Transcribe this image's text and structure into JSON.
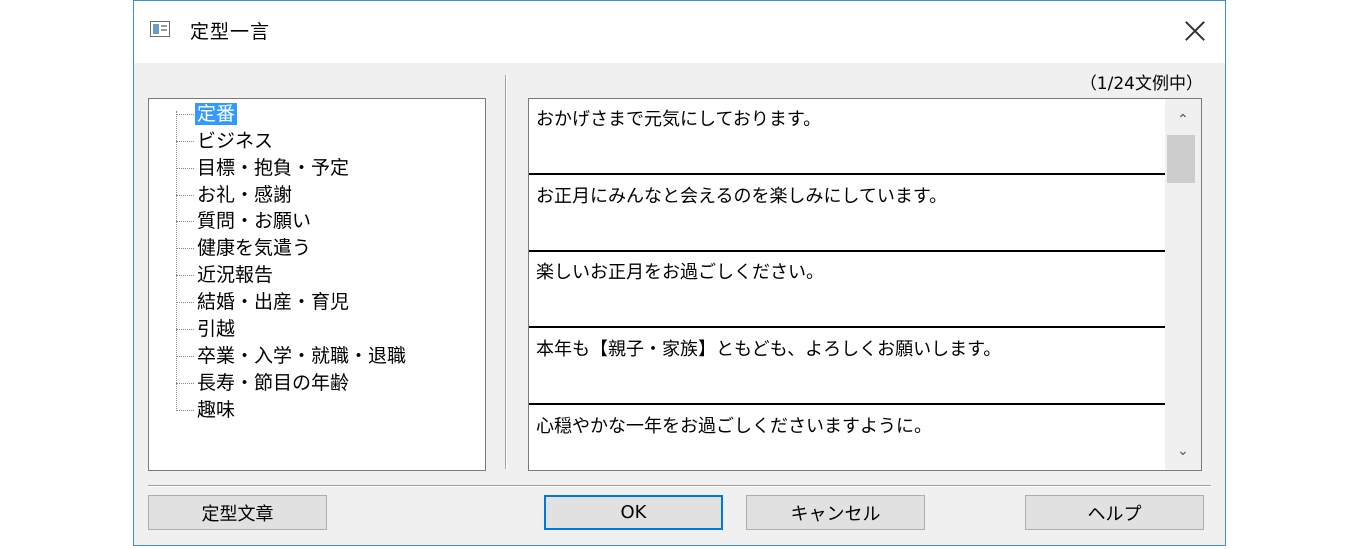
{
  "window": {
    "title": "定型一言",
    "counter": "（1/24文例中）"
  },
  "categories": [
    "定番",
    "ビジネス",
    "目標・抱負・予定",
    "お礼・感謝",
    "質問・お願い",
    "健康を気遣う",
    "近況報告",
    "結婚・出産・育児",
    "引越",
    "卒業・入学・就職・退職",
    "長寿・節目の年齢",
    "趣味"
  ],
  "selected_category": "定番",
  "phrases": [
    "おかげさまで元気にしております。",
    "お正月にみんなと会えるのを楽しみにしています。",
    "楽しいお正月をお過ごしください。",
    "本年も【親子・家族】ともども、よろしくお願いします。",
    "心穏やかな一年をお過ごしくださいますように。"
  ],
  "buttons": {
    "template": "定型文章",
    "ok": "OK",
    "cancel": "キャンセル",
    "help": "ヘルプ"
  },
  "icons": {
    "app": "window-icon",
    "close": "close-icon",
    "scroll_up": "chevron-up-icon",
    "scroll_down": "chevron-down-icon"
  },
  "colors": {
    "selection": "#3399ff",
    "default_button_border": "#0078d7",
    "window_border": "#3c8fd4"
  }
}
